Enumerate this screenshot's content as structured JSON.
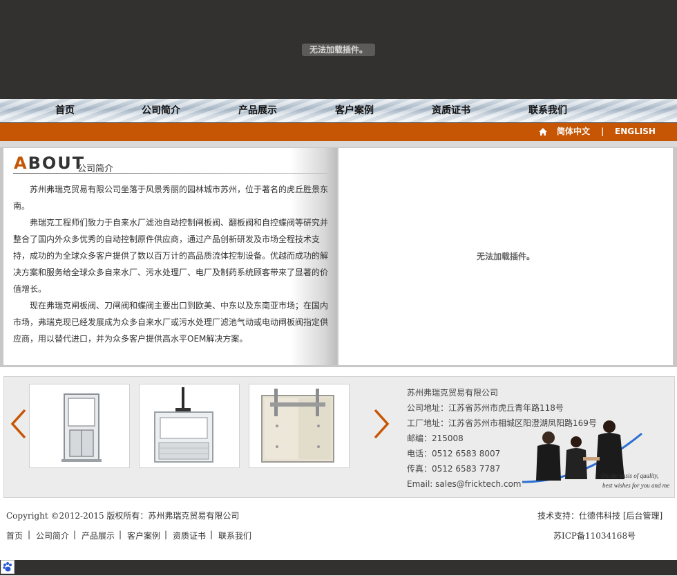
{
  "banner": {
    "plugin_message": "无法加载插件。"
  },
  "nav": {
    "items": [
      "首页",
      "公司简介",
      "产品展示",
      "客户案例",
      "资质证书",
      "联系我们"
    ]
  },
  "lang_bar": {
    "chinese": "简体中文",
    "separator": "|",
    "english": "ENGLISH"
  },
  "about": {
    "title_big": "ABOUT",
    "title_small": "公司简介",
    "paragraphs": [
      "苏州弗瑞克贸易有限公司坐落于风景秀丽的园林城市苏州，位于著名的虎丘胜景东南。",
      "弗瑞克工程师们致力于自来水厂滤池自动控制闸板阀、翻板阀和自控蝶阀等研究并整合了国内外众多优秀的自动控制原件供应商，通过产品创新研发及市场全程技术支持，成功的为全球众多客户提供了数以百万计的高品质流体控制设备。优越而成功的解决方案和服务给全球众多自来水厂、污水处理厂、电厂及制药系统顾客带来了显著的价值增长。",
      "现在弗瑞克闸板阀、刀闸阀和蝶阀主要出口到欧美、中东以及东南亚市场；在国内市场，弗瑞克现已经发展成为众多自来水厂或污水处理厂滤池气动或电动闸板阀指定供应商，用以替代进口，并为众多客户提供高水平OEM解决方案。"
    ]
  },
  "plugin_panel": {
    "message": "无法加载插件。"
  },
  "contact": {
    "company": "苏州弗瑞克贸易有限公司",
    "address": "公司地址：江苏省苏州市虎丘青年路118号",
    "factory": "工厂地址：江苏省苏州市相城区阳澄湖凤阳路169号",
    "postcode": "邮编：215008",
    "phone": "电话：0512 6583 8007",
    "fax": "传真：0512 6583 7787",
    "email": "Email: sales@fricktech.com",
    "slogan_line1": "On the basis of quality,",
    "slogan_line2": "best wishes for you and me"
  },
  "footer": {
    "copyright": "Copyright ©2012-2015 版权所有：苏州弗瑞克贸易有限公司",
    "support": "技术支持：仕德伟科技 [后台管理]",
    "links": [
      "首页",
      "公司简介",
      "产品展示",
      "客户案例",
      "资质证书",
      "联系我们"
    ],
    "link_separator": "|",
    "icp": "苏ICP备11034168号"
  },
  "colors": {
    "accent": "#c65603",
    "dark": "#323130",
    "nav_text": "#111111"
  },
  "icons": {
    "home": "home-icon",
    "prev": "chevron-left-icon",
    "next": "chevron-right-icon",
    "baidu": "paw-icon"
  }
}
